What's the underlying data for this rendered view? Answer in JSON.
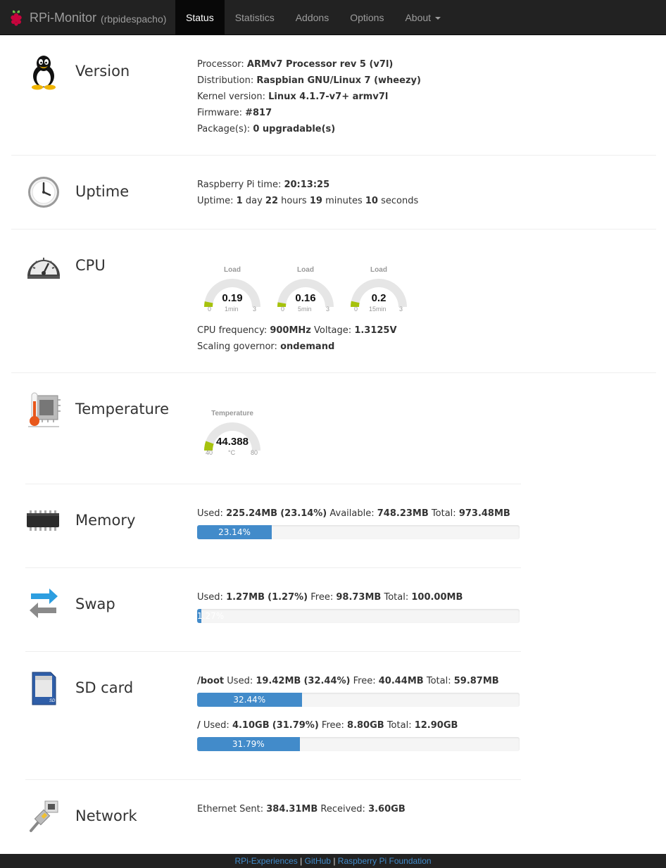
{
  "navbar": {
    "brand": "RPi-Monitor",
    "host": "(rbpidespacho)",
    "items": [
      "Status",
      "Statistics",
      "Addons",
      "Options",
      "About"
    ]
  },
  "version": {
    "title": "Version",
    "processor_label": "Processor:",
    "processor": "ARMv7 Processor rev 5 (v7l)",
    "distribution_label": "Distribution:",
    "distribution": "Raspbian GNU/Linux 7 (wheezy)",
    "kernel_label": "Kernel version:",
    "kernel": "Linux 4.1.7-v7+ armv7l",
    "firmware_label": "Firmware:",
    "firmware": "#817",
    "packages_label": "Package(s):",
    "packages": "0 upgradable(s)"
  },
  "uptime": {
    "title": "Uptime",
    "time_label": "Raspberry Pi time:",
    "time": "20:13:25",
    "uptime_label": "Uptime:",
    "days": "1",
    "days_unit": "day",
    "hours": "22",
    "hours_unit": "hours",
    "minutes": "19",
    "minutes_unit": "minutes",
    "seconds": "10",
    "seconds_unit": "seconds"
  },
  "cpu": {
    "title": "CPU",
    "gauges": [
      {
        "title": "Load",
        "value": "0.19",
        "num": 0.19,
        "min": "0",
        "max": "3",
        "label": "1min"
      },
      {
        "title": "Load",
        "value": "0.16",
        "num": 0.16,
        "min": "0",
        "max": "3",
        "label": "5min"
      },
      {
        "title": "Load",
        "value": "0.2",
        "num": 0.2,
        "min": "0",
        "max": "3",
        "label": "15min"
      }
    ],
    "freq_label": "CPU frequency:",
    "freq": "900MHz",
    "voltage_label": "Voltage:",
    "voltage": "1.3125V",
    "governor_label": "Scaling governor:",
    "governor": "ondemand"
  },
  "temperature": {
    "title": "Temperature",
    "gauge": {
      "title": "Temperature",
      "value": "44.388",
      "num": 44.388,
      "min": "40",
      "max": "80",
      "label": "°C"
    }
  },
  "memory": {
    "title": "Memory",
    "used_label": "Used:",
    "used": "225.24MB",
    "pct": "(23.14%)",
    "avail_label": "Available:",
    "avail": "748.23MB",
    "total_label": "Total:",
    "total": "973.48MB",
    "bar_text": "23.14%",
    "bar_pct": 23.14
  },
  "swap": {
    "title": "Swap",
    "used_label": "Used:",
    "used": "1.27MB",
    "pct": "(1.27%)",
    "free_label": "Free:",
    "free": "98.73MB",
    "total_label": "Total:",
    "total": "100.00MB",
    "bar_text": "1.27%",
    "bar_pct": 1.27
  },
  "sdcard": {
    "title": "SD card",
    "boot": {
      "mount": "/boot",
      "used_label": "Used:",
      "used": "19.42MB",
      "pct": "(32.44%)",
      "free_label": "Free:",
      "free": "40.44MB",
      "total_label": "Total:",
      "total": "59.87MB",
      "bar_text": "32.44%",
      "bar_pct": 32.44
    },
    "root": {
      "mount": "/",
      "used_label": "Used:",
      "used": "4.10GB",
      "pct": "(31.79%)",
      "free_label": "Free:",
      "free": "8.80GB",
      "total_label": "Total:",
      "total": "12.90GB",
      "bar_text": "31.79%",
      "bar_pct": 31.79
    }
  },
  "network": {
    "title": "Network",
    "sent_label": "Ethernet Sent:",
    "sent": "384.31MB",
    "recv_label": "Received:",
    "recv": "3.60GB"
  },
  "footer": {
    "link1": "RPi-Experiences",
    "sep": "|",
    "link2": "GitHub",
    "link3": "Raspberry Pi Foundation"
  },
  "colors": {
    "navbar": "#222222",
    "accent": "#428bca",
    "gauge_fill": "#a6c20d",
    "gauge_bg": "#e6e6e6"
  }
}
